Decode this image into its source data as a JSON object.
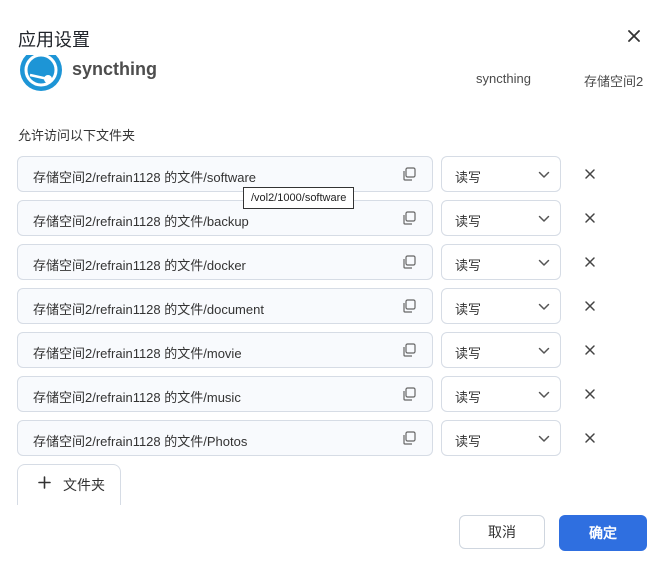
{
  "dialog": {
    "title": "应用设置"
  },
  "app": {
    "name": "syncthing",
    "user": "syncthing",
    "volume": "存储空间2"
  },
  "section_label": "允许访问以下文件夹",
  "folders": [
    {
      "path": "存储空间2/refrain1128 的文件/software",
      "permission": "读写"
    },
    {
      "path": "存储空间2/refrain1128 的文件/backup",
      "permission": "读写"
    },
    {
      "path": "存储空间2/refrain1128 的文件/docker",
      "permission": "读写"
    },
    {
      "path": "存储空间2/refrain1128 的文件/document",
      "permission": "读写"
    },
    {
      "path": "存储空间2/refrain1128 的文件/movie",
      "permission": "读写"
    },
    {
      "path": "存储空间2/refrain1128 的文件/music",
      "permission": "读写"
    },
    {
      "path": "存储空间2/refrain1128 的文件/Photos",
      "permission": "读写"
    }
  ],
  "tooltip": "/vol2/1000/software",
  "add_folder_label": "文件夹",
  "buttons": {
    "cancel": "取消",
    "confirm": "确定"
  },
  "icons": {
    "close": "close-icon",
    "copy": "copy-icon",
    "dropdown": "chevron-down-icon",
    "remove": "remove-icon",
    "add": "plus-icon",
    "app_logo": "syncthing-logo"
  },
  "colors": {
    "primary": "#2f6fe0",
    "app_logo": "#1d95d6"
  }
}
